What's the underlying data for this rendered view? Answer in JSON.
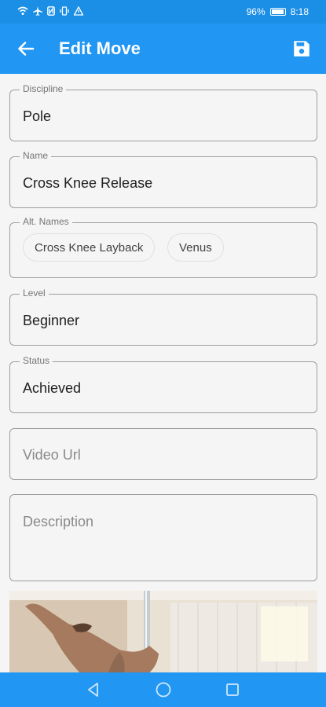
{
  "status_bar": {
    "battery": "96%",
    "time": "8:18"
  },
  "app_bar": {
    "title": "Edit Move",
    "back_icon": "arrow-left-icon",
    "save_icon": "save-icon"
  },
  "form": {
    "discipline": {
      "label": "Discipline",
      "value": "Pole"
    },
    "name": {
      "label": "Name",
      "value": "Cross Knee Release"
    },
    "alt_names": {
      "label": "Alt. Names",
      "chips": [
        "Cross Knee Layback",
        "Venus"
      ]
    },
    "level": {
      "label": "Level",
      "value": "Beginner"
    },
    "status": {
      "label": "Status",
      "value": "Achieved"
    },
    "video_url": {
      "placeholder": "Video Url"
    },
    "description": {
      "placeholder": "Description"
    }
  },
  "colors": {
    "primary": "#2196f3",
    "status_bar": "#1b8fe6",
    "background": "#f5f5f5"
  },
  "nav_bar": {
    "icons": [
      "back-triangle-icon",
      "home-circle-icon",
      "recents-square-icon"
    ]
  }
}
